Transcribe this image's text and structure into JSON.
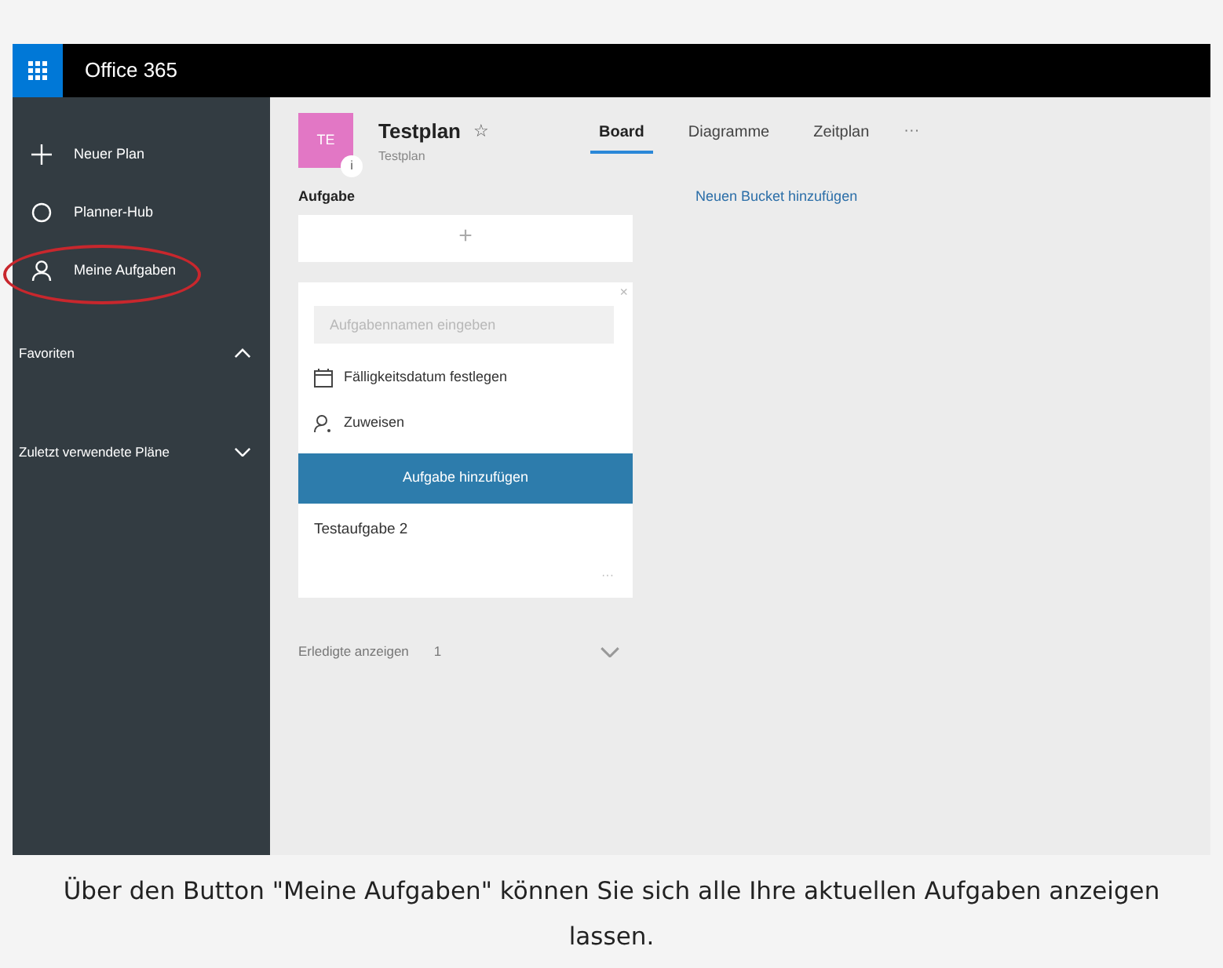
{
  "app_bar": {
    "title": "Office 365"
  },
  "sidebar": {
    "items": [
      {
        "kind": "plus",
        "label": "Neuer Plan",
        "highlighted": false
      },
      {
        "kind": "circle",
        "label": "Planner-Hub",
        "highlighted": false
      },
      {
        "kind": "person",
        "label": "Meine Aufgaben",
        "highlighted": true
      }
    ],
    "sections": [
      {
        "label": "Favoriten",
        "expanded": true
      },
      {
        "label": "Zuletzt verwendete Pläne",
        "expanded": false
      }
    ]
  },
  "plan": {
    "avatar": "TE",
    "badge": "i",
    "title": "Testplan",
    "star": "☆",
    "subtitle": "Testplan"
  },
  "tabs": [
    {
      "label": "Board",
      "selected": true
    },
    {
      "label": "Diagramme",
      "selected": false
    },
    {
      "label": "Zeitplan",
      "selected": false
    }
  ],
  "more": "···",
  "bucket": {
    "title": "Aufgabe",
    "add": "+",
    "form": {
      "close": "×",
      "placeholder": "Aufgabennamen eingeben",
      "due_date": "Fälligkeitsdatum festlegen",
      "assign": "Zuweisen",
      "submit": "Aufgabe hinzufügen"
    },
    "tasks": [
      {
        "title": "Testaufgabe 2",
        "menu": "···"
      }
    ],
    "completed": {
      "label": "Erledigte anzeigen",
      "count": "1",
      "expanded": false
    }
  },
  "new_bucket": "Neuen Bucket hinzufügen",
  "caption": "Über den Button \"Meine Aufgaben\" können Sie sich alle Ihre aktuellen Aufgaben anzeigen lassen."
}
